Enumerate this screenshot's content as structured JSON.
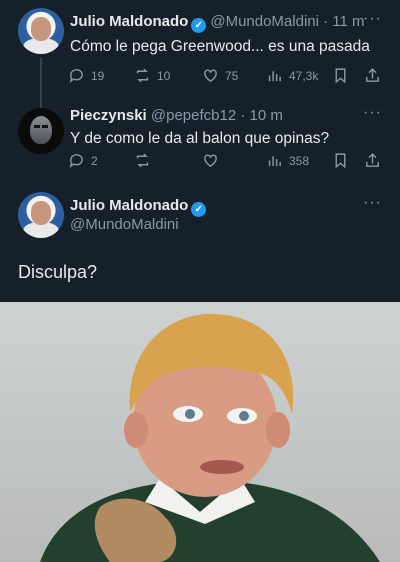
{
  "tweet1": {
    "name": "Julio Maldonado",
    "handle": "@MundoMaldini",
    "time": "· 11 m",
    "text": "Cómo le pega Greenwood... es una pasada",
    "replies": "19",
    "retweets": "10",
    "likes": "75",
    "views": "47,3k"
  },
  "tweet2": {
    "name": "Pieczynski",
    "handle": "@pepefcb12",
    "time": "· 10 m",
    "text": "Y de como le da al balon que opinas?",
    "replies": "2",
    "retweets": "",
    "likes": "",
    "views": "358"
  },
  "tweet3": {
    "name": "Julio Maldonado",
    "handle": "@MundoMaldini",
    "text": "Disculpa?"
  },
  "more_glyph": "···",
  "verified_glyph": "✓",
  "colors": {
    "background": "#15202b",
    "text": "#e7e9ea",
    "muted": "#8b98a5",
    "verified": "#1d9bf0"
  }
}
